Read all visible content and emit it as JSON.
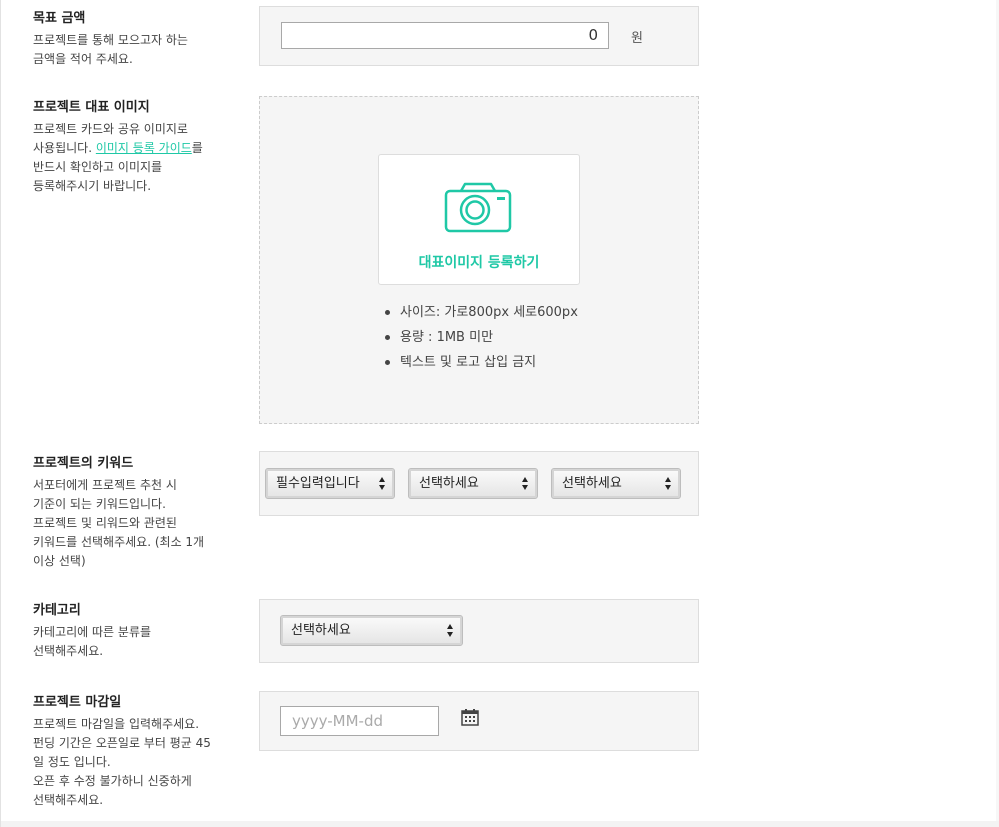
{
  "goal": {
    "title": "목표 금액",
    "desc": "프로젝트를 통해 모으고자 하는\n금액을 적어 주세요.",
    "value": "0",
    "unit": "원"
  },
  "image": {
    "title": "프로젝트 대표 이미지",
    "desc_before": "프로젝트 카드와 공유 이미지로\n사용됩니다. ",
    "guide_link": "이미지 등록 가이드",
    "desc_after": "를\n반드시 확인하고 이미지를\n등록해주시기 바랍니다.",
    "upload_label": "대표이미지 등록하기",
    "rules": [
      "사이즈: 가로800px 세로600px",
      "용량 : 1MB 미만",
      "텍스트 및 로고 삽입 금지"
    ]
  },
  "keyword": {
    "title": "프로젝트의 키워드",
    "desc": "서포터에게 프로젝트 추천 시\n기준이 되는 키워드입니다.\n프로젝트 및 리워드와 관련된\n키워드를 선택해주세요. (최소 1개\n이상 선택)",
    "selects": [
      "필수입력입니다",
      "선택하세요",
      "선택하세요"
    ]
  },
  "category": {
    "title": "카테고리",
    "desc": "카테고리에 따른 분류를\n선택해주세요.",
    "select": "선택하세요"
  },
  "deadline": {
    "title": "프로젝트 마감일",
    "desc": "프로젝트 마감일을 입력해주세요.\n펀딩 기간은 오픈일로 부터 평균 45\n일 정도 입니다.\n오픈 후 수정 불가하니 신중하게\n선택해주세요.",
    "placeholder": "yyyy-MM-dd"
  },
  "colors": {
    "accent": "#1fc8a6",
    "box_bg": "#f5f5f5",
    "border": "#dddddd"
  },
  "icons": {
    "camera": "camera-icon",
    "calendar": "calendar-icon",
    "select_arrows": "select-arrows-icon"
  }
}
